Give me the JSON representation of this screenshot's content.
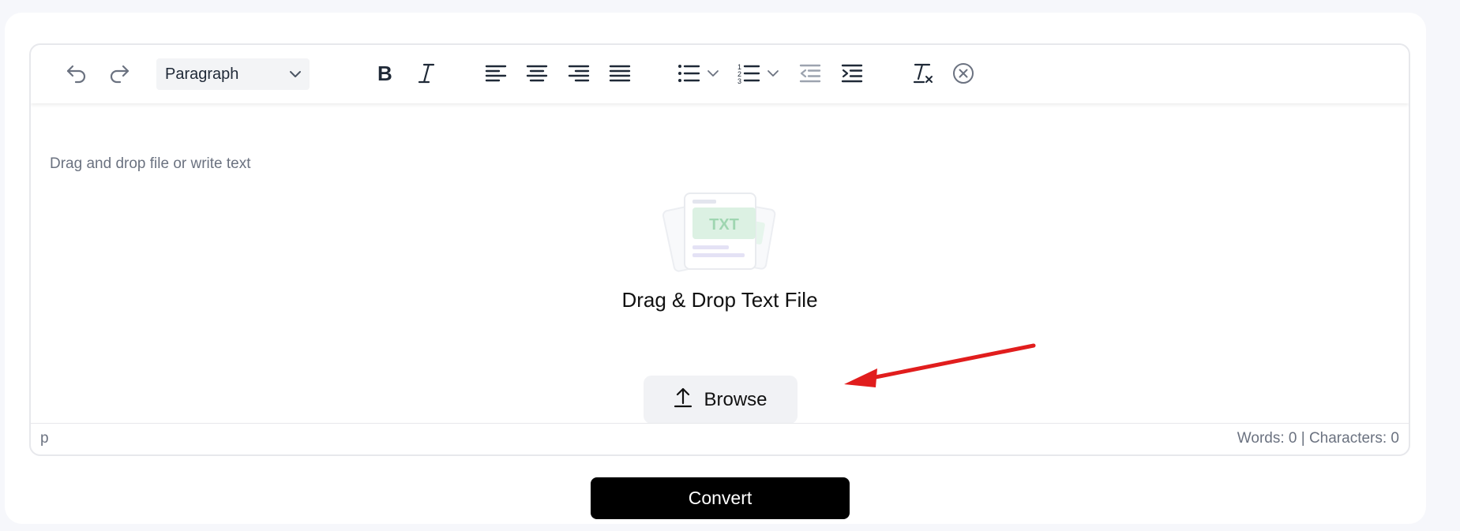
{
  "toolbar": {
    "undo_icon": "undo-icon",
    "redo_icon": "redo-icon",
    "block_format": "Paragraph",
    "bold_icon": "bold-icon",
    "italic_icon": "italic-icon",
    "align_icons": [
      "align-left-icon",
      "align-center-icon",
      "align-right-icon",
      "align-justify-icon"
    ],
    "list_icons": [
      "bullet-list-icon",
      "numbered-list-icon"
    ],
    "indent_icons": [
      "outdent-icon",
      "indent-icon"
    ],
    "clear_format_icon": "clear-formatting-icon",
    "close_icon": "close-circle-icon"
  },
  "editor": {
    "placeholder": "Drag and drop file or write text",
    "dropzone_badge": "TXT",
    "dropzone_title": "Drag & Drop Text File",
    "browse_label": "Browse"
  },
  "statusbar": {
    "element_path": "p",
    "counts": "Words: 0 | Characters: 0"
  },
  "actions": {
    "convert_label": "Convert"
  },
  "colors": {
    "annotation_arrow": "#e11d1d",
    "convert_bg": "#000000"
  }
}
